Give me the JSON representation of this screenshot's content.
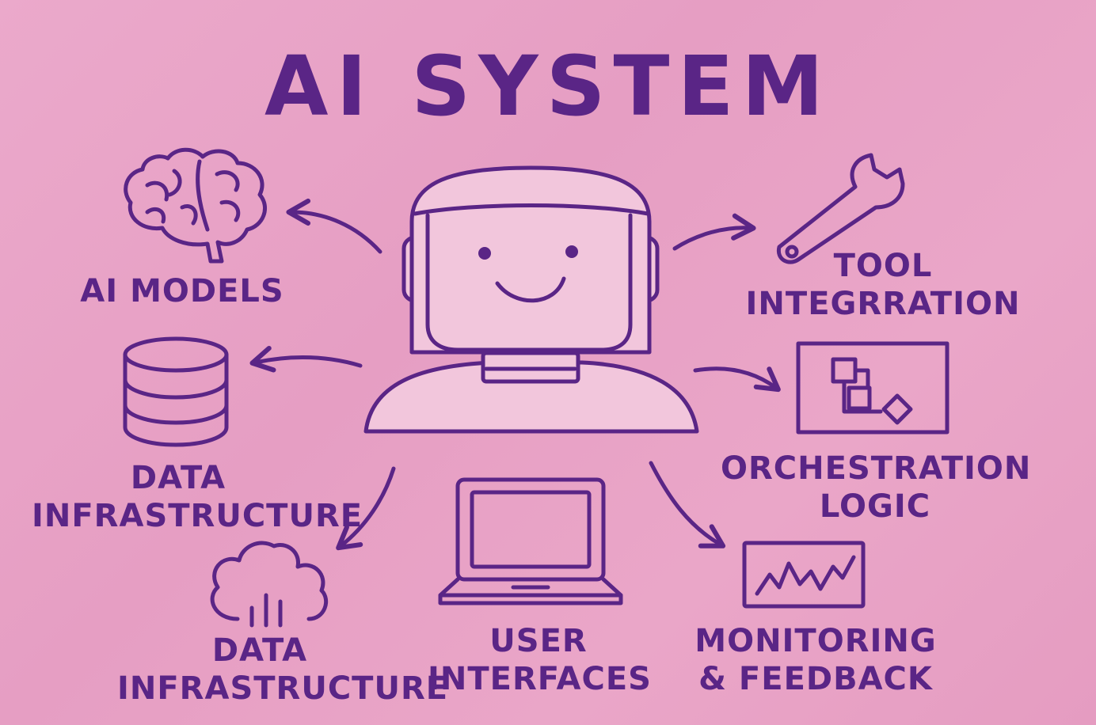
{
  "title": "AI SYSTEM",
  "colors": {
    "background": "#e9a3c6",
    "ink": "#5a2586",
    "fill": "#f2c6dc"
  },
  "center": {
    "icon": "robot-icon"
  },
  "components": [
    {
      "id": "ai-models",
      "icon": "brain-icon",
      "lines": [
        "AI MODELS"
      ]
    },
    {
      "id": "data-infrastructure-1",
      "icon": "database-icon",
      "lines": [
        "DATA",
        "INFRASTRUCTURE"
      ]
    },
    {
      "id": "data-infrastructure-2",
      "icon": "cloud-icon",
      "lines": [
        "DATA",
        "INFRASTRUCTURE"
      ]
    },
    {
      "id": "user-interfaces",
      "icon": "laptop-icon",
      "lines": [
        "USER",
        "INTERFACES"
      ]
    },
    {
      "id": "monitoring-feedback",
      "icon": "monitor-chart-icon",
      "lines": [
        "MONITORING",
        "& FEEDBACK"
      ]
    },
    {
      "id": "orchestration-logic",
      "icon": "flowchart-icon",
      "lines": [
        "ORCHESTRATION",
        "LOGIC"
      ]
    },
    {
      "id": "tool-integration",
      "icon": "wrench-icon",
      "lines": [
        "TOOL",
        "INTEGRRATION"
      ]
    }
  ]
}
